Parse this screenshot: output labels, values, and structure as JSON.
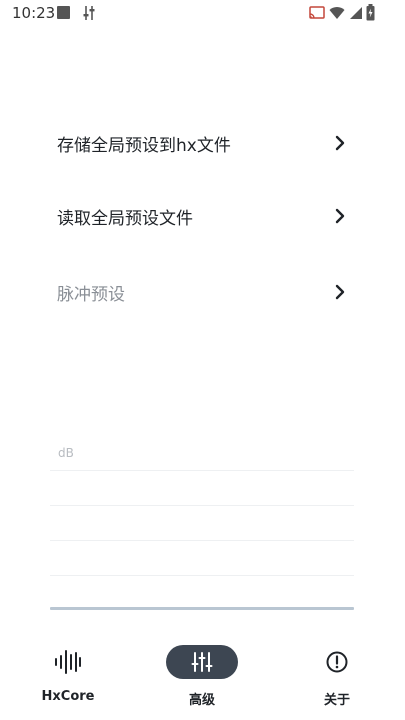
{
  "status_bar": {
    "time": "10:23",
    "icons": [
      "square-notification-icon",
      "tune-icon",
      "cast-icon",
      "wifi-icon",
      "signal-icon",
      "battery-charging-icon"
    ]
  },
  "menu": {
    "items": [
      {
        "label": "存储全局预设到hx文件",
        "enabled": true,
        "icon": "chevron-right-icon"
      },
      {
        "label": "读取全局预设文件",
        "enabled": true,
        "icon": "chevron-right-icon"
      },
      {
        "label": "脉冲预设",
        "enabled": false,
        "icon": "chevron-right-icon"
      }
    ]
  },
  "chart": {
    "y_unit_label": "dB"
  },
  "bottom_nav": {
    "items": [
      {
        "label": "HxCore",
        "icon": "waveform-icon",
        "active": false
      },
      {
        "label": "高级",
        "icon": "equalizer-sliders-icon",
        "active": true
      },
      {
        "label": "关于",
        "icon": "info-circle-icon",
        "active": false
      }
    ]
  },
  "colors": {
    "active_nav_bg": "#3d4652",
    "text_primary": "#1f2328",
    "text_disabled": "#8a8f96",
    "chart_base": "#b9c6d2"
  }
}
